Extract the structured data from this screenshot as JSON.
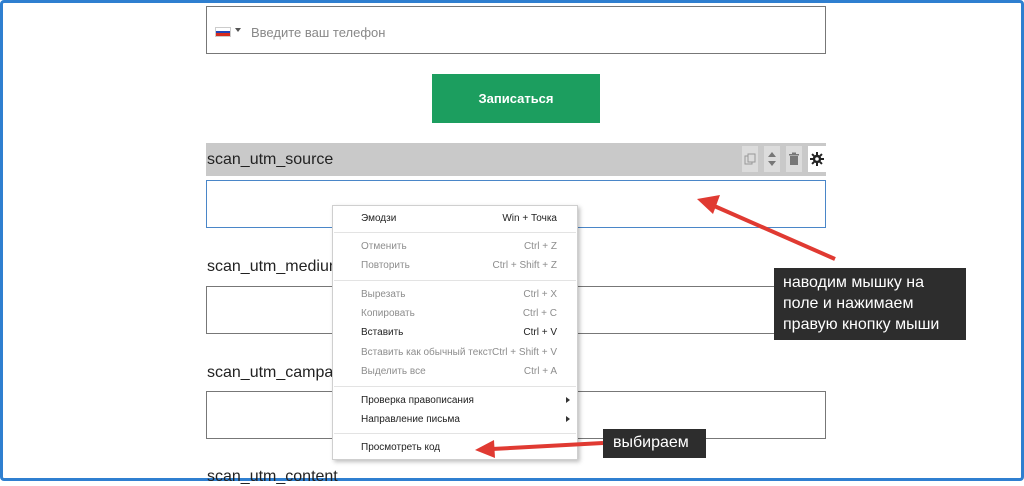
{
  "phone": {
    "placeholder": "Введите ваш телефон"
  },
  "submit_label": "Записаться",
  "fields": [
    {
      "label": "scan_utm_source"
    },
    {
      "label": "scan_utm_medium"
    },
    {
      "label": "scan_utm_campaign"
    },
    {
      "label": "scan_utm_content"
    }
  ],
  "context_menu": {
    "items": [
      {
        "label": "Эмодзи",
        "shortcut": "Win + Точка",
        "enabled": true
      },
      {
        "label": "Отменить",
        "shortcut": "Ctrl + Z",
        "enabled": false
      },
      {
        "label": "Повторить",
        "shortcut": "Ctrl + Shift + Z",
        "enabled": false
      },
      {
        "label": "Вырезать",
        "shortcut": "Ctrl + X",
        "enabled": false
      },
      {
        "label": "Копировать",
        "shortcut": "Ctrl + C",
        "enabled": false
      },
      {
        "label": "Вставить",
        "shortcut": "Ctrl + V",
        "enabled": true
      },
      {
        "label": "Вставить как обычный текст",
        "shortcut": "Ctrl + Shift + V",
        "enabled": false
      },
      {
        "label": "Выделить все",
        "shortcut": "Ctrl + A",
        "enabled": false
      },
      {
        "label": "Проверка правописания",
        "submenu": true,
        "enabled": true
      },
      {
        "label": "Направление письма",
        "submenu": true,
        "enabled": true
      },
      {
        "label": "Просмотреть код",
        "enabled": true
      }
    ]
  },
  "annotations": {
    "right_click_note": [
      "наводим мышку на",
      "поле и нажимаем",
      "правую кнопку мыши"
    ],
    "choose_note": "выбираем"
  },
  "colors": {
    "frame": "#2f7fd0",
    "submit_bg": "#1c9e5f",
    "arrow": "#e03a32",
    "callout_bg": "#2d2d2d",
    "field_header_bg": "#c9c9c9"
  }
}
